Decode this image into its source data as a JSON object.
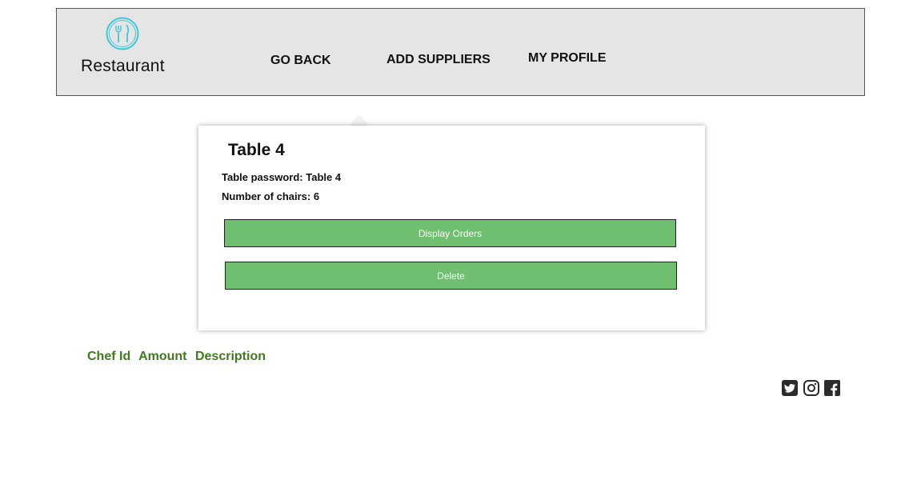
{
  "header": {
    "logo_text": "Restaurant",
    "nav": {
      "go_back": "GO BACK",
      "add_suppliers": "ADD SUPPLIERS",
      "my_profile": "MY PROFILE"
    }
  },
  "table_card": {
    "title": "Table 4",
    "password_label": "Table password:",
    "password_value": "Table 4",
    "chairs_label": "Number of chairs:",
    "chairs_value": "6",
    "display_orders_button": "Display Orders",
    "delete_button": "Delete"
  },
  "orders_table": {
    "columns": [
      "Chef Id",
      "Amount",
      "Description"
    ]
  },
  "social": [
    "twitter-icon",
    "instagram-icon",
    "facebook-icon"
  ],
  "colors": {
    "header_bg": "#e5e5e5",
    "button_green": "#70bf71",
    "column_header_green": "#3f7a1f",
    "logo_cyan": "#3cc8d8"
  }
}
